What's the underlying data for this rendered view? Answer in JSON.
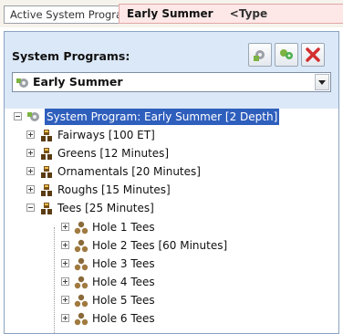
{
  "header": {
    "active_label": "Active System Program :",
    "program_name": "Early Summer",
    "type_label": "<Type"
  },
  "panel": {
    "title": "System Programs:",
    "combo_value": "Early Summer"
  },
  "tree": {
    "root": "System Program: Early Summer  [2 Depth]",
    "groups": [
      {
        "label": "Fairways  [100 ET]"
      },
      {
        "label": "Greens  [12 Minutes]"
      },
      {
        "label": "Ornamentals  [20 Minutes]"
      },
      {
        "label": "Roughs  [15 Minutes]"
      },
      {
        "label": "Tees  [25 Minutes]"
      }
    ],
    "children": [
      {
        "label": "Hole 1 Tees"
      },
      {
        "label": "Hole 2 Tees  [60 Minutes]"
      },
      {
        "label": "Hole 3 Tees"
      },
      {
        "label": "Hole 4 Tees"
      },
      {
        "label": "Hole 5 Tees"
      },
      {
        "label": "Hole 6 Tees"
      }
    ]
  },
  "colors": {
    "selection": "#2f5fbd",
    "panel_bg": "#dbe8f7",
    "badge_bg": "#fde7e7"
  },
  "icons": [
    "program-icon",
    "add-program-icon",
    "copy-program-icon",
    "delete-icon",
    "station-group-icon",
    "station-icon"
  ]
}
